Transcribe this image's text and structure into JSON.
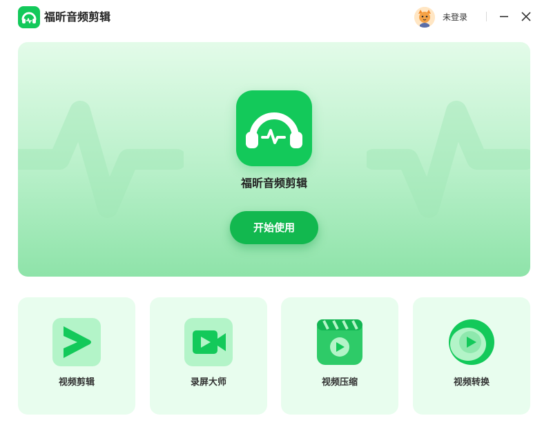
{
  "titlebar": {
    "app_name": "福昕音频剪辑",
    "login_text": "未登录",
    "icons": [
      "app-logo-icon",
      "avatar-icon",
      "minimize-icon",
      "close-icon"
    ]
  },
  "hero": {
    "title": "福昕音频剪辑",
    "start_button": "开始使用"
  },
  "features": [
    {
      "label": "视频剪辑",
      "icon": "video-edit-icon"
    },
    {
      "label": "录屏大师",
      "icon": "screen-record-icon"
    },
    {
      "label": "视频压缩",
      "icon": "video-compress-icon"
    },
    {
      "label": "视频转换",
      "icon": "video-convert-icon"
    }
  ],
  "colors": {
    "brand_green": "#13c95a",
    "button_green": "#12b84f",
    "card_bg": "#e8fdee"
  }
}
